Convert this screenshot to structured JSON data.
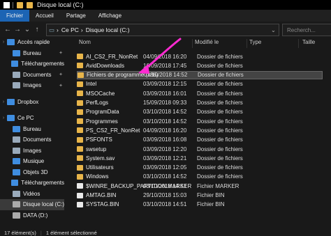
{
  "window": {
    "title": "Disque local (C:)"
  },
  "ribbon": {
    "tabs": [
      "Fichier",
      "Accueil",
      "Partage",
      "Affichage"
    ]
  },
  "address": {
    "crumbs": [
      "Ce PC",
      "Disque local (C:)"
    ]
  },
  "search": {
    "placeholder": "Recherch..."
  },
  "columns": {
    "name": "Nom",
    "date": "Modifié le",
    "type": "Type",
    "size": "Taille"
  },
  "nav": [
    {
      "label": "Accès rapide",
      "icon": "star-icon",
      "level": 0,
      "color": "#3f8de0"
    },
    {
      "label": "Bureau",
      "icon": "desktop-folder-icon",
      "level": 1,
      "color": "#3f8de0",
      "pin": true
    },
    {
      "label": "Téléchargements",
      "icon": "download-folder-icon",
      "level": 1,
      "color": "#3f8de0",
      "pin": true
    },
    {
      "label": "Documents",
      "icon": "documents-folder-icon",
      "level": 1,
      "color": "#9ab",
      "pin": true
    },
    {
      "label": "Images",
      "icon": "pictures-folder-icon",
      "level": 1,
      "color": "#9ab",
      "pin": true
    },
    {
      "label": "",
      "icon": "",
      "level": 0,
      "color": "",
      "spacer": true
    },
    {
      "label": "Dropbox",
      "icon": "dropbox-icon",
      "level": 0,
      "color": "#3f8de0"
    },
    {
      "label": "",
      "icon": "",
      "level": 0,
      "color": "",
      "spacer": true
    },
    {
      "label": "Ce PC",
      "icon": "computer-icon",
      "level": 0,
      "color": "#3f8de0"
    },
    {
      "label": "Bureau",
      "icon": "desktop-folder-icon",
      "level": 1,
      "color": "#3f8de0"
    },
    {
      "label": "Documents",
      "icon": "documents-folder-icon",
      "level": 1,
      "color": "#9ab"
    },
    {
      "label": "Images",
      "icon": "pictures-folder-icon",
      "level": 1,
      "color": "#9ab"
    },
    {
      "label": "Musique",
      "icon": "music-folder-icon",
      "level": 1,
      "color": "#3f8de0"
    },
    {
      "label": "Objets 3D",
      "icon": "objects3d-folder-icon",
      "level": 1,
      "color": "#3f8de0"
    },
    {
      "label": "Téléchargements",
      "icon": "download-folder-icon",
      "level": 1,
      "color": "#3f8de0"
    },
    {
      "label": "Vidéos",
      "icon": "videos-folder-icon",
      "level": 1,
      "color": "#9ab"
    },
    {
      "label": "Disque local (C:)",
      "icon": "drive-icon",
      "level": 1,
      "color": "#aaa",
      "selected": true
    },
    {
      "label": "DATA (D:)",
      "icon": "drive-icon",
      "level": 1,
      "color": "#aaa"
    }
  ],
  "files": [
    {
      "name": "AI_CS2_FR_NonRet",
      "date": "04/09/2018 16:20",
      "type": "Dossier de fichiers",
      "size": "",
      "kind": "folder"
    },
    {
      "name": "AvidDownloads",
      "date": "16/09/2018 17:45",
      "type": "Dossier de fichiers",
      "size": "",
      "kind": "folder"
    },
    {
      "name": "Fichiers de programme (x86)",
      "date": "03/10/2018 14:52",
      "type": "Dossier de fichiers",
      "size": "",
      "kind": "folder",
      "selected": true
    },
    {
      "name": "Intel",
      "date": "03/09/2018 12:15",
      "type": "Dossier de fichiers",
      "size": "",
      "kind": "folder"
    },
    {
      "name": "MSOCache",
      "date": "03/09/2018 16:01",
      "type": "Dossier de fichiers",
      "size": "",
      "kind": "folder"
    },
    {
      "name": "PerfLogs",
      "date": "15/09/2018 09:33",
      "type": "Dossier de fichiers",
      "size": "",
      "kind": "folder"
    },
    {
      "name": "ProgramData",
      "date": "03/10/2018 14:52",
      "type": "Dossier de fichiers",
      "size": "",
      "kind": "folder"
    },
    {
      "name": "Programmes",
      "date": "03/10/2018 14:52",
      "type": "Dossier de fichiers",
      "size": "",
      "kind": "folder"
    },
    {
      "name": "PS_CS2_FR_NonRet",
      "date": "04/09/2018 16:20",
      "type": "Dossier de fichiers",
      "size": "",
      "kind": "folder"
    },
    {
      "name": "PSFONTS",
      "date": "03/09/2018 16:08",
      "type": "Dossier de fichiers",
      "size": "",
      "kind": "folder"
    },
    {
      "name": "swsetup",
      "date": "03/09/2018 12:20",
      "type": "Dossier de fichiers",
      "size": "",
      "kind": "folder"
    },
    {
      "name": "System.sav",
      "date": "03/09/2018 12:21",
      "type": "Dossier de fichiers",
      "size": "",
      "kind": "folder"
    },
    {
      "name": "Utilisateurs",
      "date": "03/09/2018 12:05",
      "type": "Dossier de fichiers",
      "size": "",
      "kind": "folder"
    },
    {
      "name": "Windows",
      "date": "03/10/2018 14:52",
      "type": "Dossier de fichiers",
      "size": "",
      "kind": "folder"
    },
    {
      "name": "$WINRE_BACKUP_PARTITION.MARKER",
      "date": "03/10/2018 14:51",
      "type": "Fichier MARKER",
      "size": "",
      "kind": "file"
    },
    {
      "name": "AMTAG.BIN",
      "date": "29/10/2018 15:03",
      "type": "Fichier BIN",
      "size": "",
      "kind": "file"
    },
    {
      "name": "SYSTAG.BIN",
      "date": "03/10/2018 14:51",
      "type": "Fichier BIN",
      "size": "",
      "kind": "file"
    }
  ],
  "status": {
    "count": "17 élément(s)",
    "selection": "1 élément sélectionné"
  },
  "colors": {
    "accent": "#1c64b4",
    "annotation_arrow": "#ff2bd1"
  }
}
